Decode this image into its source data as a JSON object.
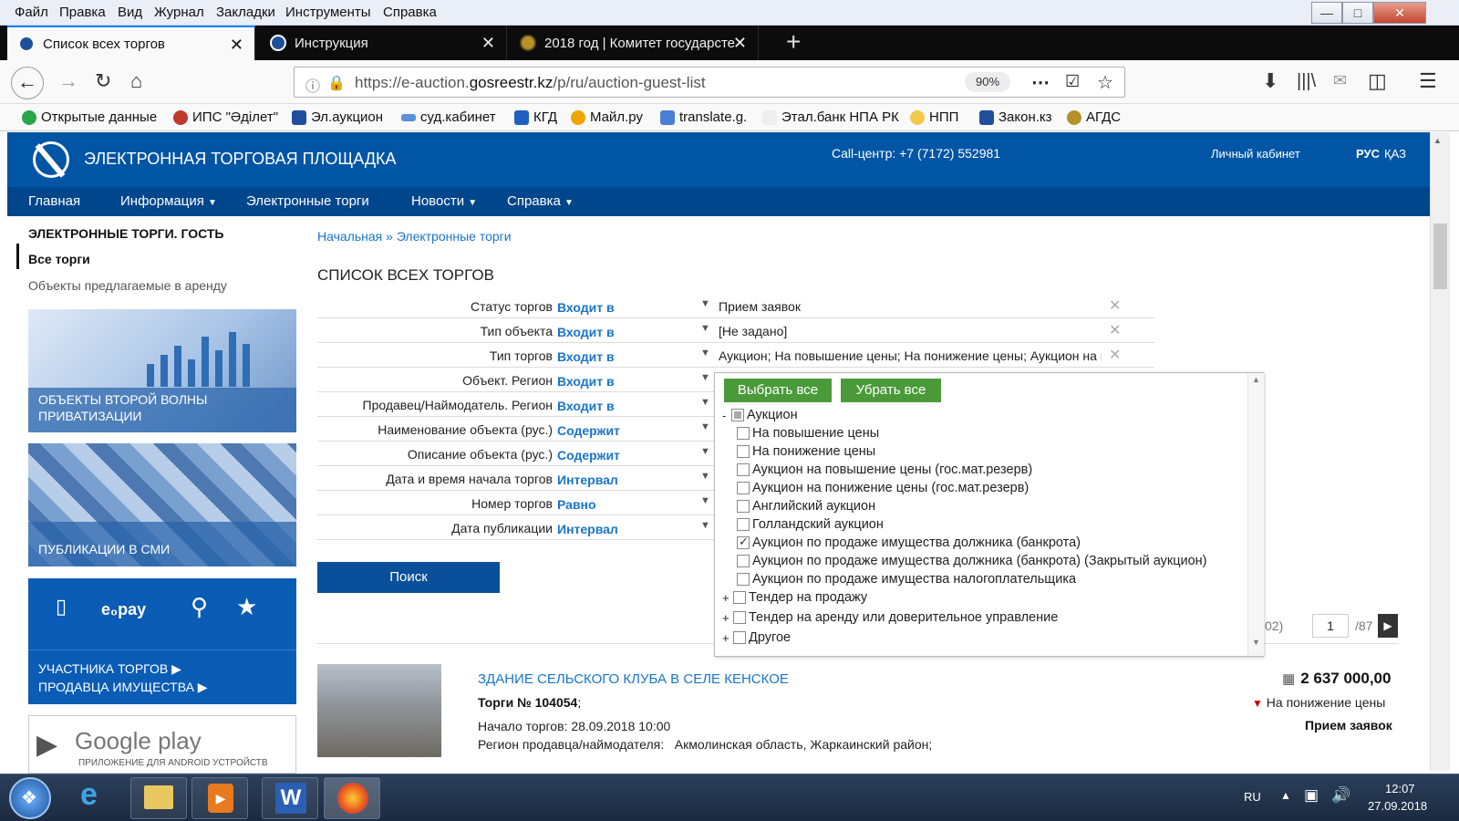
{
  "menu": [
    "Файл",
    "Правка",
    "Вид",
    "Журнал",
    "Закладки",
    "Инструменты",
    "Справка"
  ],
  "tabs": [
    {
      "title": "Список всех торгов"
    },
    {
      "title": "Инструкция"
    },
    {
      "title": "2018 год | Комитет государсте"
    }
  ],
  "url": {
    "base": "https://e-auction.",
    "domain": "gosreestr.kz",
    "path": "/p/ru/auction-guest-list",
    "zoom": "90%"
  },
  "bookmarks": [
    "Открытые данные",
    "ИПС \"Әділет\"",
    "Эл.аукцион",
    "суд.кабинет",
    "КГД",
    "Майл.ру",
    "translate.g.",
    "Этал.банк НПА РК",
    "НПП",
    "Закон.кз",
    "АГДС"
  ],
  "site": {
    "title": "ЭЛЕКТРОННАЯ ТОРГОВАЯ ПЛОЩАДКА",
    "call": "Call-центр: +7 (7172) 552981",
    "cabinet": "Личный кабинет",
    "lang_ru": "РУС",
    "lang_kz": "ҚАЗ"
  },
  "sitenav": [
    "Главная",
    "Информация",
    "Электронные торги",
    "Новости",
    "Справка"
  ],
  "sidebar": {
    "heading": "ЭЛЕКТРОННЫЕ ТОРГИ. ГОСТЬ",
    "all": "Все торги",
    "rent": "Объекты предлагаемые в аренду",
    "banner1": "ОБЪЕКТЫ ВТОРОЙ ВОЛНЫ ПРИВАТИЗАЦИИ",
    "banner2": "ПУБЛИКАЦИИ В СМИ",
    "banner3a": "УЧАСТНИКА ТОРГОВ ▶",
    "banner3b": "ПРОДАВЦА ИМУЩЕСТВА ▶",
    "epay": "e₀pay",
    "gplay": "Google play",
    "gplay_sub": "ПРИЛОЖЕНИЕ ДЛЯ ANDROID УСТРОЙСТВ"
  },
  "breadcrumb": {
    "home": "Начальная",
    "sep": "»",
    "current": "Электронные торги"
  },
  "page_title": "СПИСОК ВСЕХ ТОРГОВ",
  "filters": [
    {
      "label": "Статус торгов",
      "op": "Входит в",
      "value": "Прием заявок",
      "clear": true
    },
    {
      "label": "Тип объекта",
      "op": "Входит в",
      "value": "[Не задано]",
      "clear": true
    },
    {
      "label": "Тип торгов",
      "op": "Входит в",
      "value": "Аукцион; На повышение цены; На понижение цены; Аукцион на повышение цены (гос.мат.резерв)",
      "clear": true
    },
    {
      "label": "Объект. Регион",
      "op": "Входит в",
      "value": "",
      "clear": false
    },
    {
      "label": "Продавец/Наймодатель. Регион",
      "op": "Входит в",
      "value": "",
      "clear": false
    },
    {
      "label": "Наименование объекта (рус.)",
      "op": "Содержит",
      "value": "",
      "clear": false
    },
    {
      "label": "Описание объекта (рус.)",
      "op": "Содержит",
      "value": "",
      "clear": false
    },
    {
      "label": "Дата и время начала торгов",
      "op": "Интервал",
      "value": "",
      "clear": false
    },
    {
      "label": "Номер торгов",
      "op": "Равно",
      "value": "",
      "clear": false
    },
    {
      "label": "Дата публикации",
      "op": "Интервал",
      "value": "",
      "clear": false
    }
  ],
  "search_button": "Поиск",
  "popup": {
    "select_all": "Выбрать все",
    "clear_all": "Убрать все",
    "root": "Аукцион",
    "items": [
      {
        "label": "На повышение цены",
        "checked": false
      },
      {
        "label": "На понижение цены",
        "checked": false
      },
      {
        "label": "Аукцион на повышение цены (гос.мат.резерв)",
        "checked": false
      },
      {
        "label": "Аукцион на понижение цены (гос.мат.резерв)",
        "checked": false
      },
      {
        "label": "Английский аукцион",
        "checked": false
      },
      {
        "label": "Голландский аукцион",
        "checked": false
      },
      {
        "label": "Аукцион по продаже имущества должника (банкрота)",
        "checked": true
      },
      {
        "label": "Аукцион по продаже имущества должника (банкрота) (Закрытый аукцион)",
        "checked": false
      },
      {
        "label": "Аукцион по продаже имущества налогоплательщика",
        "checked": false
      }
    ],
    "groups": [
      "Тендер на продажу",
      "Тендер на аренду или доверительное управление",
      "Другое"
    ]
  },
  "pager": {
    "left_text": "02)",
    "page": "1",
    "total": "/87"
  },
  "result": {
    "title": "ЗДАНИЕ СЕЛЬСКОГО КЛУБА В СЕЛЕ КЕНСКОЕ",
    "number_label": "Торги № 104054",
    "number_suffix": ";",
    "start_label": "Начало торгов:",
    "start": "28.09.2018 10:00",
    "region_label": "Регион продавца/наймодателя:",
    "region": "Акмолинская область, Жаркаинский район;",
    "price": "2 637 000,00",
    "type": "На понижение цены",
    "status": "Прием заявок"
  },
  "taskbar": {
    "lang": "RU",
    "time": "12:07",
    "date": "27.09.2018"
  }
}
